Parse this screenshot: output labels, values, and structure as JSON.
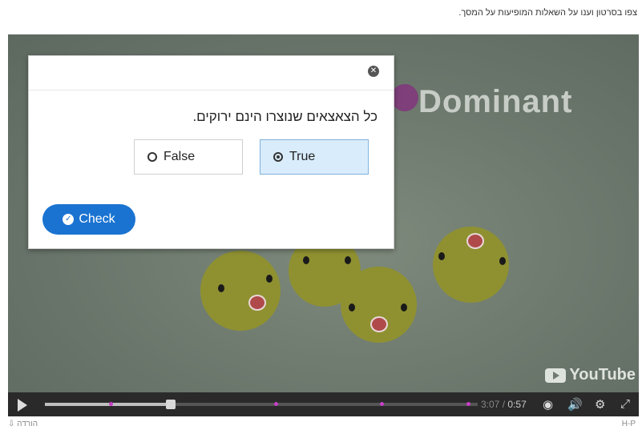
{
  "page": {
    "instruction": "צפו בסרטון וענו על השאלות המופיעות על המסך."
  },
  "video": {
    "overlay_title": "Dominant",
    "watermark": "YouTube",
    "current_time": "3:07",
    "duration": "0:57",
    "progress_fraction": 0.29
  },
  "quiz": {
    "question": "כל הצאצאים שנוצרו הינם ירוקים.",
    "options": [
      {
        "label": "False",
        "selected": false
      },
      {
        "label": "True",
        "selected": true
      }
    ],
    "check_label": "Check"
  },
  "footer": {
    "left": "הורדה",
    "right": "H-P"
  },
  "colors": {
    "accent": "#1a73d1",
    "selected_bg": "#d9ecfb",
    "video_bg": "#6e7a6f"
  }
}
